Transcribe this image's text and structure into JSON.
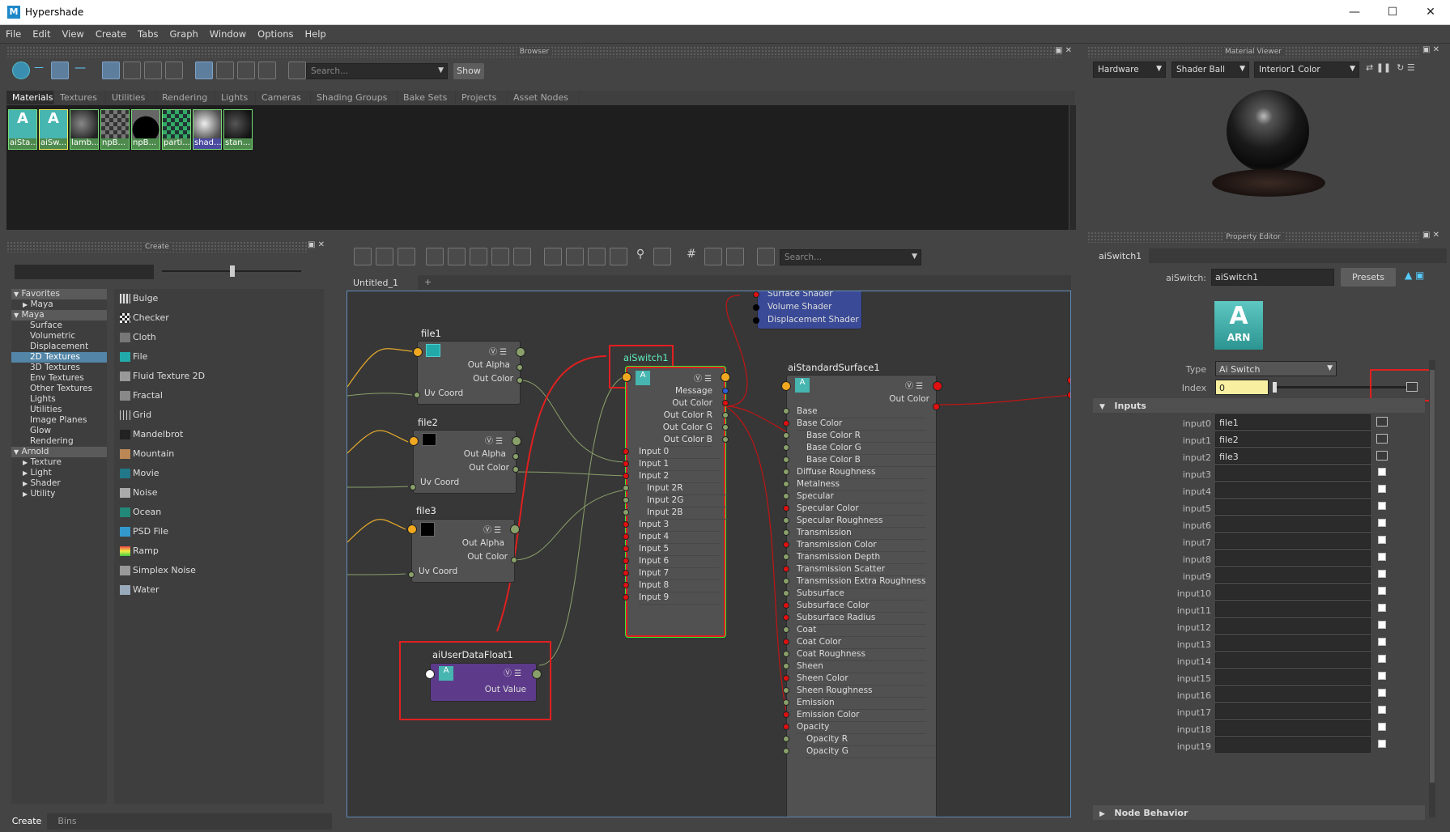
{
  "window": {
    "title": "Hypershade",
    "app_icon": "M"
  },
  "menu": [
    "File",
    "Edit",
    "View",
    "Create",
    "Tabs",
    "Graph",
    "Window",
    "Options",
    "Help"
  ],
  "browser": {
    "header": "Browser",
    "search_placeholder": "Search...",
    "show_label": "Show",
    "tabs": [
      "Materials",
      "Textures",
      "Utilities",
      "Rendering",
      "Lights",
      "Cameras",
      "Shading Groups",
      "Bake Sets",
      "Projects",
      "Asset Nodes"
    ],
    "swatches": [
      "aiSta...",
      "aiSw...",
      "lamb...",
      "npB...",
      "npB...",
      "parti...",
      "shad...",
      "stan..."
    ]
  },
  "create": {
    "header": "Create",
    "tree": [
      "Favorites",
      "Maya",
      "Maya",
      "Surface",
      "Volumetric",
      "Displacement",
      "2D Textures",
      "3D Textures",
      "Env Textures",
      "Other Textures",
      "Lights",
      "Utilities",
      "Image Planes",
      "Glow",
      "Rendering",
      "Arnold",
      "Texture",
      "Light",
      "Shader",
      "Utility"
    ],
    "items": [
      "Bulge",
      "Checker",
      "Cloth",
      "File",
      "Fluid Texture 2D",
      "Fractal",
      "Grid",
      "Mandelbrot",
      "Mountain",
      "Movie",
      "Noise",
      "Ocean",
      "PSD File",
      "Ramp",
      "Simplex Noise",
      "Water"
    ],
    "bottom_tabs": [
      "Create",
      "Bins"
    ]
  },
  "graph": {
    "search_placeholder": "Search...",
    "tab": "Untitled_1",
    "add_tab": "+",
    "file1": {
      "title": "file1",
      "out_alpha": "Out Alpha",
      "out_color": "Out Color",
      "uv": "Uv Coord"
    },
    "file2": {
      "title": "file2",
      "out_alpha": "Out Alpha",
      "out_color": "Out Color",
      "uv": "Uv Coord"
    },
    "file3": {
      "title": "file3",
      "out_alpha": "Out Alpha",
      "out_color": "Out Color",
      "uv": "Uv Coord"
    },
    "userdata": {
      "title": "aiUserDataFloat1",
      "out": "Out Value"
    },
    "sg": {
      "rows": [
        "Surface Shader",
        "Volume Shader",
        "Displacement Shader"
      ]
    },
    "switch": {
      "title": "aiSwitch1",
      "rows": [
        "Message",
        "Out Color",
        "Out Color R",
        "Out Color G",
        "Out Color B",
        "Input 0",
        "Input 1",
        "Input 2",
        "Input 2R",
        "Input 2G",
        "Input 2B",
        "Input 3",
        "Input 4",
        "Input 5",
        "Input 6",
        "Input 7",
        "Input 8",
        "Input 9"
      ]
    },
    "standard": {
      "title": "aiStandardSurface1",
      "out": "Out Color",
      "rows": [
        "Base",
        "Base Color",
        "Base Color R",
        "Base Color G",
        "Base Color B",
        "Diffuse Roughness",
        "Metalness",
        "Specular",
        "Specular Color",
        "Specular Roughness",
        "Transmission",
        "Transmission Color",
        "Transmission Depth",
        "Transmission Scatter",
        "Transmission Extra Roughness",
        "Subsurface",
        "Subsurface Color",
        "Subsurface Radius",
        "Coat",
        "Coat Color",
        "Coat Roughness",
        "Sheen",
        "Sheen Color",
        "Sheen Roughness",
        "Emission",
        "Emission Color",
        "Opacity",
        "Opacity R",
        "Opacity G"
      ]
    }
  },
  "viewer": {
    "header": "Material Viewer",
    "renderer": "Hardware",
    "geometry": "Shader Ball",
    "env": "Interior1 Color"
  },
  "property": {
    "header": "Property Editor",
    "tab": "aiSwitch1",
    "node_label": "aiSwitch:",
    "node_value": "aiSwitch1",
    "presets": "Presets",
    "badge_top": "A",
    "badge_bottom": "ARN",
    "type_label": "Type",
    "type_value": "Ai Switch",
    "index_label": "Index",
    "index_value": "0",
    "inputs_section": "Inputs",
    "inputs": [
      {
        "label": "input0",
        "value": "file1"
      },
      {
        "label": "input1",
        "value": "file2"
      },
      {
        "label": "input2",
        "value": "file3"
      },
      {
        "label": "input3",
        "value": ""
      },
      {
        "label": "input4",
        "value": ""
      },
      {
        "label": "input5",
        "value": ""
      },
      {
        "label": "input6",
        "value": ""
      },
      {
        "label": "input7",
        "value": ""
      },
      {
        "label": "input8",
        "value": ""
      },
      {
        "label": "input9",
        "value": ""
      },
      {
        "label": "input10",
        "value": ""
      },
      {
        "label": "input11",
        "value": ""
      },
      {
        "label": "input12",
        "value": ""
      },
      {
        "label": "input13",
        "value": ""
      },
      {
        "label": "input14",
        "value": ""
      },
      {
        "label": "input15",
        "value": ""
      },
      {
        "label": "input16",
        "value": ""
      },
      {
        "label": "input17",
        "value": ""
      },
      {
        "label": "input18",
        "value": ""
      },
      {
        "label": "input19",
        "value": ""
      }
    ],
    "node_behavior": "Node Behavior"
  }
}
